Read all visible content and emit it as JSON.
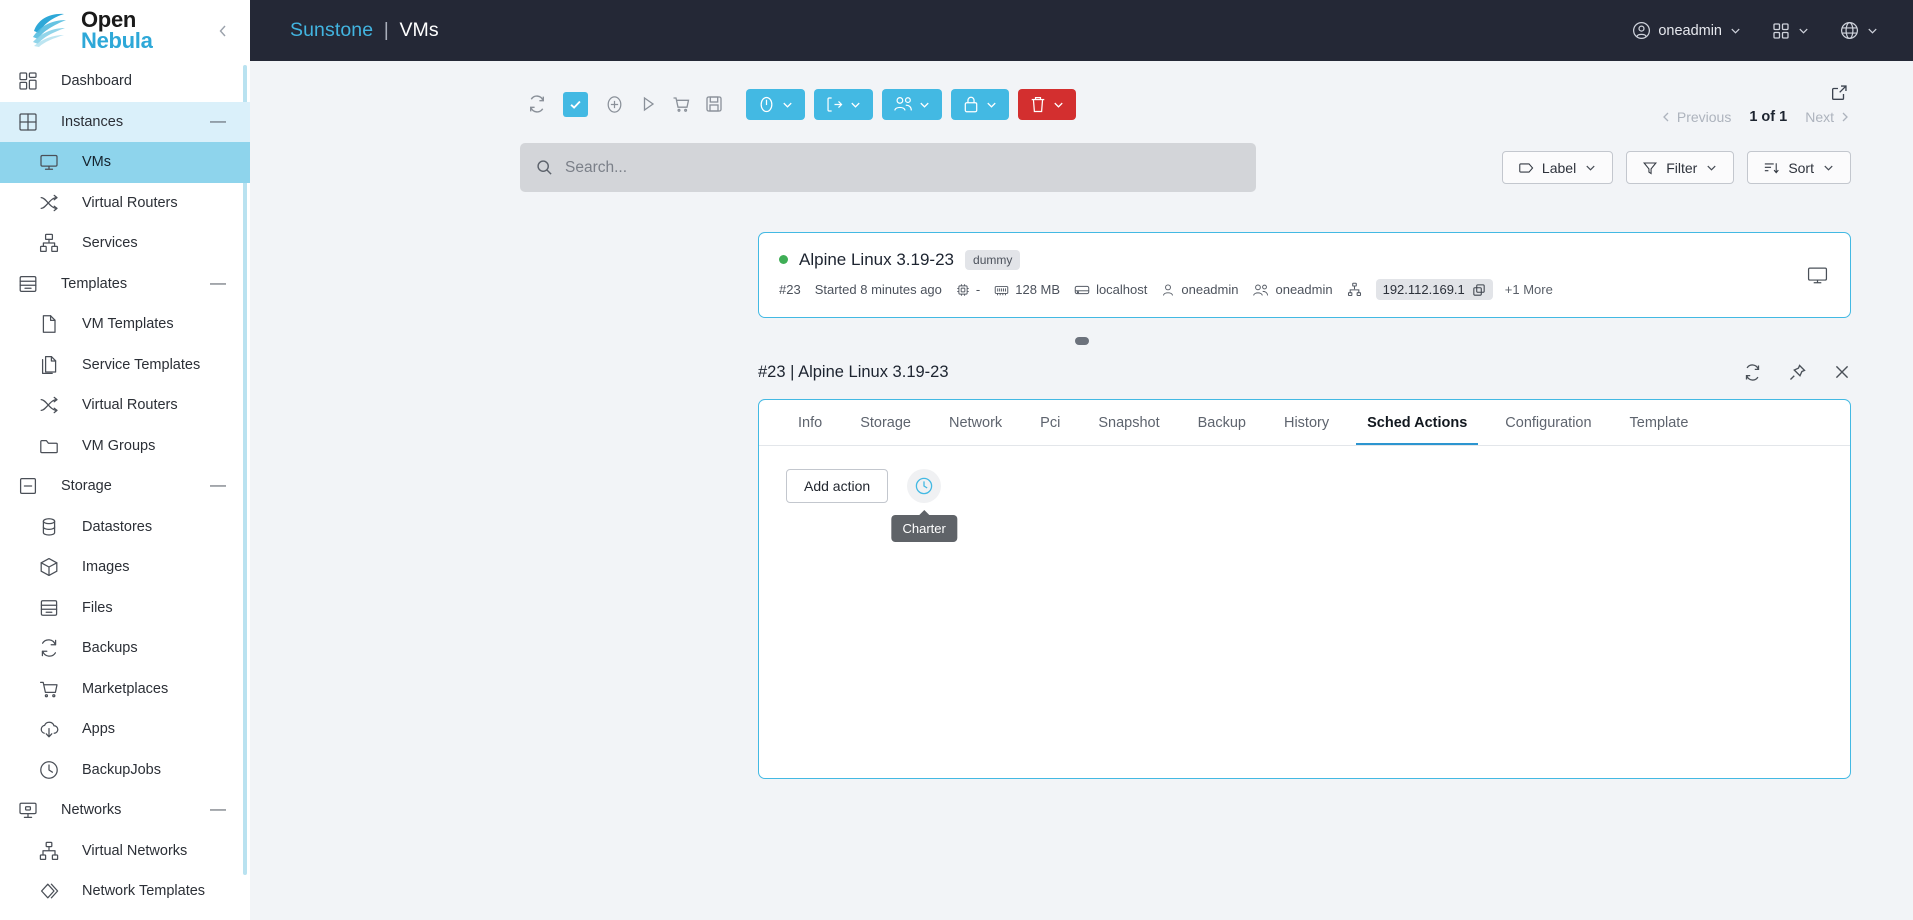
{
  "brand": {
    "line1": "Open",
    "line2": "Nebula",
    "collapse_icon": "chevron-left-icon"
  },
  "sidebar": {
    "items": [
      {
        "label": "Dashboard",
        "icon": "dashboard-icon",
        "level": "group",
        "state": "normal",
        "collapsible": false
      },
      {
        "label": "Instances",
        "icon": "instances-grid-icon",
        "level": "group",
        "state": "expanded",
        "collapsible": true
      },
      {
        "label": "VMs",
        "icon": "monitor-icon",
        "level": "child",
        "state": "active",
        "collapsible": false
      },
      {
        "label": "Virtual Routers",
        "icon": "shuffle-icon",
        "level": "child",
        "state": "normal",
        "collapsible": false
      },
      {
        "label": "Services",
        "icon": "services-tree-icon",
        "level": "child",
        "state": "normal",
        "collapsible": false
      },
      {
        "label": "Templates",
        "icon": "templates-archive-icon",
        "level": "group",
        "state": "normal",
        "collapsible": true
      },
      {
        "label": "VM Templates",
        "icon": "file-icon",
        "level": "child",
        "state": "normal",
        "collapsible": false
      },
      {
        "label": "Service Templates",
        "icon": "files-copy-icon",
        "level": "child",
        "state": "normal",
        "collapsible": false
      },
      {
        "label": "Virtual Routers",
        "icon": "shuffle-icon",
        "level": "child",
        "state": "normal",
        "collapsible": false
      },
      {
        "label": "VM Groups",
        "icon": "folder-icon",
        "level": "child",
        "state": "normal",
        "collapsible": false
      },
      {
        "label": "Storage",
        "icon": "storage-box-icon",
        "level": "group",
        "state": "normal",
        "collapsible": true
      },
      {
        "label": "Datastores",
        "icon": "database-icon",
        "level": "child",
        "state": "normal",
        "collapsible": false
      },
      {
        "label": "Images",
        "icon": "cube-icon",
        "level": "child",
        "state": "normal",
        "collapsible": false
      },
      {
        "label": "Files",
        "icon": "archive-icon",
        "level": "child",
        "state": "normal",
        "collapsible": false
      },
      {
        "label": "Backups",
        "icon": "refresh-cycle-icon",
        "level": "child",
        "state": "normal",
        "collapsible": false
      },
      {
        "label": "Marketplaces",
        "icon": "cart-icon",
        "level": "child",
        "state": "normal",
        "collapsible": false
      },
      {
        "label": "Apps",
        "icon": "cloud-download-icon",
        "level": "child",
        "state": "normal",
        "collapsible": false
      },
      {
        "label": "BackupJobs",
        "icon": "clock-icon",
        "level": "child",
        "state": "normal",
        "collapsible": false
      },
      {
        "label": "Networks",
        "icon": "network-monitor-icon",
        "level": "group",
        "state": "normal",
        "collapsible": true
      },
      {
        "label": "Virtual Networks",
        "icon": "network-tree-icon",
        "level": "child",
        "state": "normal",
        "collapsible": false
      },
      {
        "label": "Network Templates",
        "icon": "diamonds-icon",
        "level": "child",
        "state": "normal",
        "collapsible": false
      }
    ],
    "collapse_symbol": "—"
  },
  "topbar": {
    "app_name": "Sunstone",
    "separator": "|",
    "section": "VMs",
    "user": "oneadmin",
    "user_icon": "user-circle-icon",
    "apps_icon": "apps-grid-icon",
    "lang_icon": "globe-icon",
    "chevron": "chevron-down-icon",
    "bg_color": "#242836",
    "accent_color": "#42b4e0"
  },
  "toolbar": {
    "refresh_icon": "refresh-icon",
    "select_all_icon": "checkbox-checked-icon",
    "create_icon": "plus-circle-icon",
    "play_icon": "play-icon",
    "cart_icon": "cart-icon",
    "save_icon": "floppy-save-icon",
    "groups": [
      {
        "name": "state-actions",
        "icon": "power-icon",
        "chevron": "chevron-down-icon",
        "color": "#43b9e3"
      },
      {
        "name": "migrate-actions",
        "icon": "migrate-icon",
        "chevron": "chevron-down-icon",
        "color": "#43b9e3"
      },
      {
        "name": "ownership-actions",
        "icon": "users-icon",
        "chevron": "chevron-down-icon",
        "color": "#43b9e3"
      },
      {
        "name": "lock-actions",
        "icon": "lock-icon",
        "chevron": "chevron-down-icon",
        "color": "#43b9e3"
      },
      {
        "name": "delete-actions",
        "icon": "trash-icon",
        "chevron": "chevron-down-icon",
        "color": "#d32f2f"
      }
    ]
  },
  "pagination": {
    "external_icon": "external-link-icon",
    "previous": "Previous",
    "count": "1 of 1",
    "next": "Next",
    "prev_chevron": "chevron-left-icon",
    "next_chevron": "chevron-right-icon"
  },
  "search": {
    "placeholder": "Search...",
    "value": "",
    "icon": "search-icon"
  },
  "filters": [
    {
      "label": "Label",
      "icon": "tag-icon",
      "chevron": "chevron-down-icon"
    },
    {
      "label": "Filter",
      "icon": "funnel-icon",
      "chevron": "chevron-down-icon"
    },
    {
      "label": "Sort",
      "icon": "sort-icon",
      "chevron": "chevron-down-icon"
    }
  ],
  "vm_card": {
    "status": "running",
    "status_color": "#3fae56",
    "name": "Alpine Linux 3.19-23",
    "tag": "dummy",
    "id": "#23",
    "started": "Started 8 minutes ago",
    "cpu_icon": "cpu-icon",
    "cpu": "-",
    "memory_icon": "ram-icon",
    "memory": "128 MB",
    "host_icon": "host-icon",
    "host": "localhost",
    "owner_icon": "user-icon",
    "owner": "oneadmin",
    "group_icon": "group-icon",
    "group": "oneadmin",
    "network_icon": "network-tree-icon",
    "ip": "192.112.169.1",
    "copy_icon": "copy-icon",
    "more": "+1 More",
    "vnc_icon": "monitor-icon"
  },
  "detail": {
    "title": "#23 | Alpine Linux 3.19-23",
    "actions": [
      {
        "name": "refresh-detail",
        "icon": "refresh-icon"
      },
      {
        "name": "pin-detail",
        "icon": "pin-icon"
      },
      {
        "name": "close-detail",
        "icon": "close-icon"
      }
    ],
    "tabs": [
      {
        "label": "Info",
        "active": false
      },
      {
        "label": "Storage",
        "active": false
      },
      {
        "label": "Network",
        "active": false
      },
      {
        "label": "Pci",
        "active": false
      },
      {
        "label": "Snapshot",
        "active": false
      },
      {
        "label": "Backup",
        "active": false
      },
      {
        "label": "History",
        "active": false
      },
      {
        "label": "Sched Actions",
        "active": true
      },
      {
        "label": "Configuration",
        "active": false
      },
      {
        "label": "Template",
        "active": false
      }
    ],
    "sched_actions": {
      "add_action_label": "Add action",
      "charter_icon": "clock-icon",
      "tooltip": "Charter"
    }
  }
}
